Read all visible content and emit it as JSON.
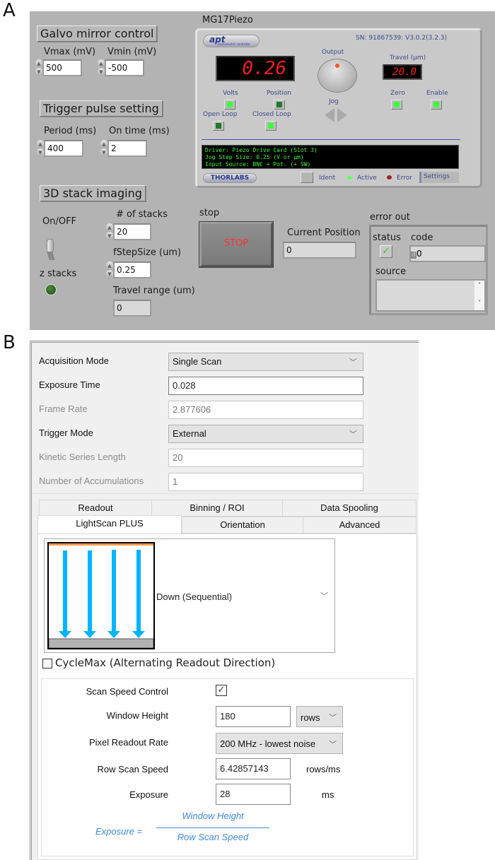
{
  "figure_labels": {
    "a": "A",
    "b": "B"
  },
  "panel_a": {
    "galvo": {
      "title": "Galvo mirror control",
      "vmax_label": "Vmax (mV)",
      "vmax_value": "500",
      "vmin_label": "Vmin (mV)",
      "vmin_value": "-500"
    },
    "trigger": {
      "title": "Trigger pulse setting",
      "period_label": "Period (ms)",
      "period_value": "400",
      "ontime_label": "On time (ms)",
      "ontime_value": "2"
    },
    "stack": {
      "title": "3D stack imaging",
      "onoff_label": "On/OFF",
      "zstacks_label": "z stacks",
      "num_stacks_label": "# of stacks",
      "num_stacks_value": "20",
      "step_label": "fStepSize (um)",
      "step_value": "0.25",
      "travel_label": "Travel range (um)",
      "travel_value": "0"
    },
    "piezo": {
      "title": "MG17Piezo",
      "logo": "apt",
      "logo_sub": "piezoelectric controller",
      "serial": "SN: 91867539: V3.0.2(3.2.3)",
      "display_value": "0.26",
      "output_label": "Output",
      "travel_label": "Travel (µm)",
      "travel_value": "20.0",
      "volts_label": "Volts",
      "position_label": "Position",
      "jog_label": "Jog",
      "zero_label": "Zero",
      "enable_label": "Enable",
      "open_loop_label": "Open Loop",
      "closed_loop_label": "Closed Loop",
      "info_lines": [
        "Driver: Piezo Drive Card (Slot 3)",
        "Jog Step Size: 0.25 (V or µm)",
        "Input Source: BNC + Pot. (+ SW)"
      ],
      "brand": "THORLABS",
      "ident_label": "Ident",
      "active_label": "Active",
      "error_label": "Error",
      "settings_label": "Settings"
    },
    "stop": {
      "label": "stop",
      "button_text": "STOP"
    },
    "current_position": {
      "label": "Current Position",
      "value": "0"
    },
    "error_out": {
      "label": "error out",
      "status_label": "status",
      "code_label": "code",
      "code_prefix": "d",
      "code_value": "0",
      "source_label": "source",
      "source_value": ""
    },
    "colors": {
      "panel_bg": "#b3b3b3",
      "led_green": "#33ff33",
      "segment_red": "#ff1a1a",
      "stop_text": "#ff3333"
    }
  },
  "panel_b": {
    "rows": [
      {
        "label": "Acquisition Mode",
        "value": "Single Scan",
        "type": "select",
        "disabled": false
      },
      {
        "label": "Exposure Time",
        "value": "0.028",
        "type": "input",
        "disabled": false
      },
      {
        "label": "Frame Rate",
        "value": "2.877606",
        "type": "input",
        "disabled": true
      },
      {
        "label": "Trigger Mode",
        "value": "External",
        "type": "select",
        "disabled": false
      },
      {
        "label": "Kinetic Series Length",
        "value": "20",
        "type": "input",
        "disabled": true
      },
      {
        "label": "Number of Accumulations",
        "value": "1",
        "type": "input",
        "disabled": true
      }
    ],
    "tabs_row1": [
      "Readout",
      "Binning / ROI",
      "Data Spooling"
    ],
    "tabs_row2": [
      "LightScan PLUS",
      "Orientation",
      "Advanced"
    ],
    "active_tab": "LightScan PLUS",
    "scan_direction": "Down (Sequential)",
    "cyclemax_label": "CycleMax (Alternating Readout Direction)",
    "cyclemax_checked": false,
    "scan_speed_control_label": "Scan Speed Control",
    "scan_speed_control_checked": true,
    "window_height_label": "Window Height",
    "window_height_value": "180",
    "window_height_unit": "rows",
    "pixel_readout_label": "Pixel Readout Rate",
    "pixel_readout_value": "200 MHz - lowest noise",
    "row_scan_speed_label": "Row Scan Speed",
    "row_scan_speed_value": "6.42857143",
    "row_scan_speed_unit": "rows/ms",
    "exposure_label": "Exposure",
    "exposure_value": "28",
    "exposure_unit": "ms",
    "formula_lhs": "Exposure =",
    "formula_num": "Window Height",
    "formula_den": "Row Scan Speed",
    "colors": {
      "arrow_blue": "#00b4ff",
      "formula_blue": "#3f8ae0",
      "top_orange": "#ff9a4a"
    }
  }
}
